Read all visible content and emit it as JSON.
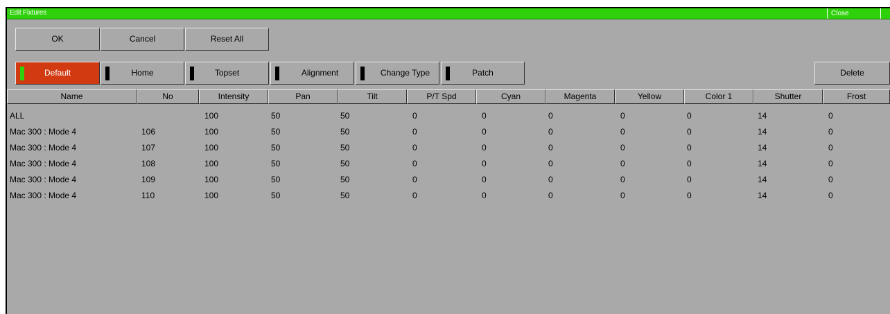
{
  "window": {
    "title": "Edit Fixtures",
    "close_label": "Close"
  },
  "actions": {
    "ok": "OK",
    "cancel": "Cancel",
    "reset_all": "Reset All"
  },
  "modes": {
    "default": "Default",
    "home": "Home",
    "topset": "Topset",
    "alignment": "Alignment",
    "change_type": "Change Type",
    "patch": "Patch",
    "delete": "Delete"
  },
  "table": {
    "columns": [
      "Name",
      "No",
      "Intensity",
      "Pan",
      "Tilt",
      "P/T Spd",
      "Cyan",
      "Magenta",
      "Yellow",
      "Color 1",
      "Shutter",
      "Frost"
    ],
    "rows": [
      [
        "ALL",
        "",
        "100",
        "50",
        "50",
        "0",
        "0",
        "0",
        "0",
        "0",
        "14",
        "0"
      ],
      [
        "Mac 300 : Mode 4",
        "106",
        "100",
        "50",
        "50",
        "0",
        "0",
        "0",
        "0",
        "0",
        "14",
        "0"
      ],
      [
        "Mac 300 : Mode 4",
        "107",
        "100",
        "50",
        "50",
        "0",
        "0",
        "0",
        "0",
        "0",
        "14",
        "0"
      ],
      [
        "Mac 300 : Mode 4",
        "108",
        "100",
        "50",
        "50",
        "0",
        "0",
        "0",
        "0",
        "0",
        "14",
        "0"
      ],
      [
        "Mac 300 : Mode 4",
        "109",
        "100",
        "50",
        "50",
        "0",
        "0",
        "0",
        "0",
        "0",
        "14",
        "0"
      ],
      [
        "Mac 300 : Mode 4",
        "110",
        "100",
        "50",
        "50",
        "0",
        "0",
        "0",
        "0",
        "0",
        "14",
        "0"
      ]
    ]
  },
  "colors": {
    "titlebar": "#2ed10a",
    "default_active": "#d23a12",
    "background": "#a9a9a9"
  }
}
